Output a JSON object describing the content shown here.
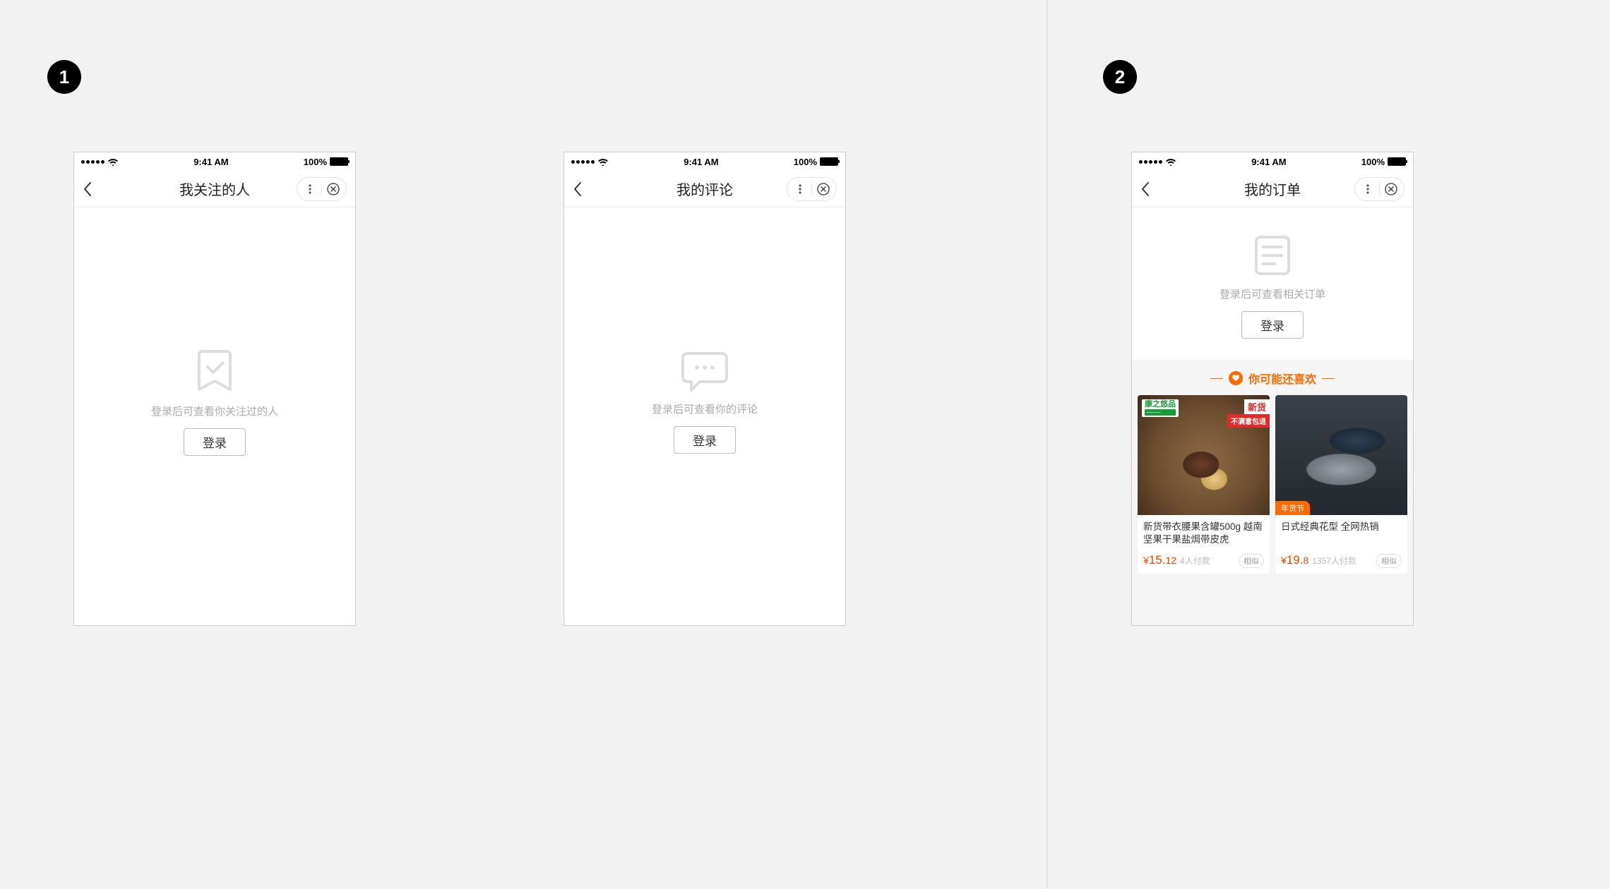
{
  "badges": {
    "one": "1",
    "two": "2"
  },
  "status": {
    "time": "9:41 AM",
    "battery": "100%"
  },
  "screens": {
    "follow": {
      "title": "我关注的人",
      "empty_text": "登录后可查看你关注过的人",
      "login": "登录"
    },
    "comments": {
      "title": "我的评论",
      "empty_text": "登录后可查看你的评论",
      "login": "登录"
    },
    "orders": {
      "title": "我的订单",
      "empty_text": "登录后可查看相关订单",
      "login": "登录",
      "reco_title": "你可能还喜欢",
      "products": [
        {
          "brand": "康之悠品",
          "new_label": "新货",
          "new_sub": "不满意包退",
          "title": "新货带衣腰果含罐500g 越南坚果干果盐焗带皮虎",
          "currency": "¥",
          "price_main": "15.",
          "price_dec": "12",
          "pay_count": "4人付款",
          "similar": "相似"
        },
        {
          "promo": "年货节",
          "title": "日式经典花型 全网热销",
          "currency": "¥",
          "price_main": "19.",
          "price_dec": "8",
          "pay_count": "1357人付款",
          "similar": "相似"
        }
      ]
    }
  }
}
